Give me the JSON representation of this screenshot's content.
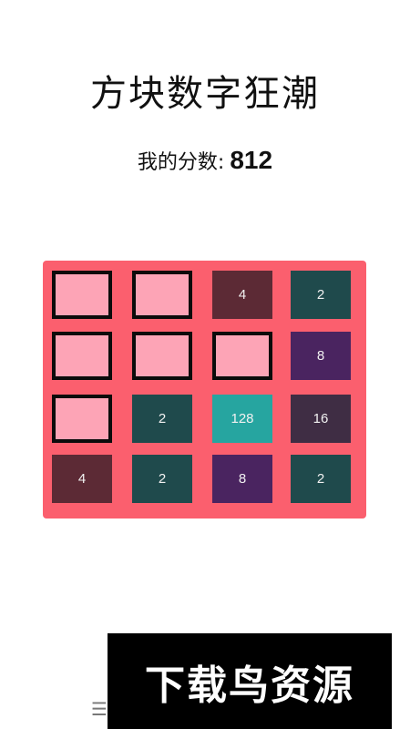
{
  "header": {
    "title": "方块数字狂潮"
  },
  "score": {
    "label": "我的分数:",
    "value": "812"
  },
  "board": {
    "rows": [
      [
        {
          "value": "",
          "state": "empty"
        },
        {
          "value": "",
          "state": "empty"
        },
        {
          "value": "4",
          "color": "#5c2a35"
        },
        {
          "value": "2",
          "color": "#1f4a4c"
        }
      ],
      [
        {
          "value": "",
          "state": "empty"
        },
        {
          "value": "",
          "state": "empty"
        },
        {
          "value": "",
          "state": "empty"
        },
        {
          "value": "8",
          "color": "#4a2460"
        }
      ],
      [
        {
          "value": "",
          "state": "empty"
        },
        {
          "value": "2",
          "color": "#1f4a4c"
        },
        {
          "value": "128",
          "color": "#26a5a0"
        },
        {
          "value": "16",
          "color": "#3f2d44"
        }
      ],
      [
        {
          "value": "4",
          "color": "#5c2a35"
        },
        {
          "value": "2",
          "color": "#1f4a4c"
        },
        {
          "value": "8",
          "color": "#4a2460"
        },
        {
          "value": "2",
          "color": "#1f4a4c"
        }
      ]
    ],
    "colors": {
      "background": "#fb5f6e",
      "empty": "#fda4b6",
      "border": "#0b0b0b"
    }
  },
  "footer": {
    "menu_icon": "menu-icon",
    "menu_glyph": "☰"
  },
  "watermark": {
    "text": "下载鸟资源"
  }
}
